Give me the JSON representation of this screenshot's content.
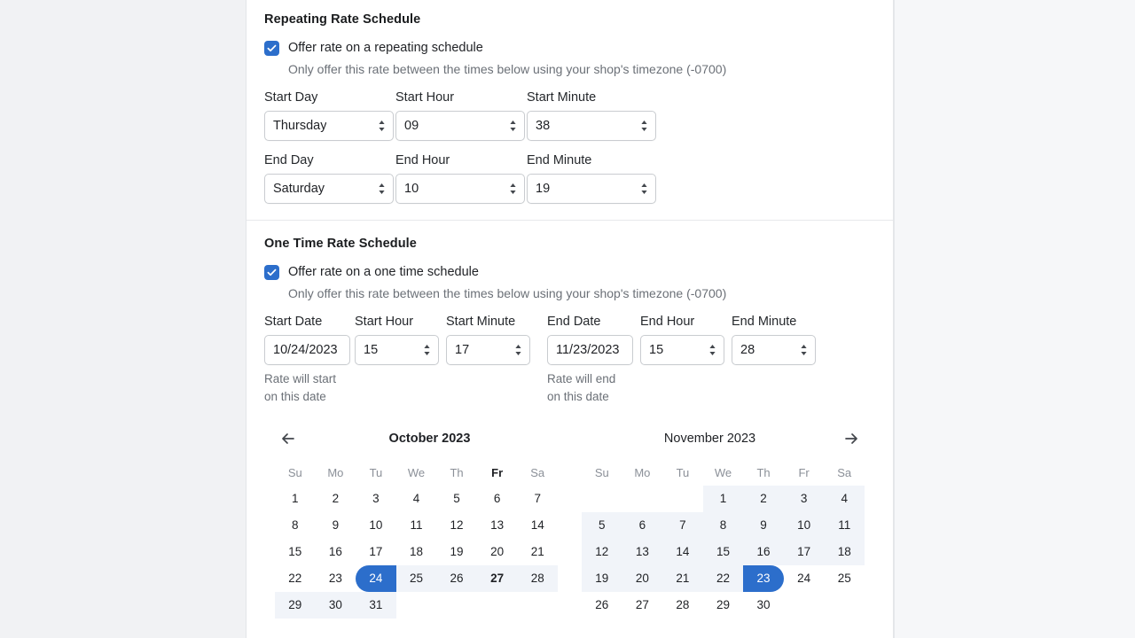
{
  "repeating": {
    "title": "Repeating Rate Schedule",
    "checkbox_label": "Offer rate on a repeating schedule",
    "helper": "Only offer this rate between the times below using your shop's timezone (-0700)",
    "fields": [
      {
        "label": "Start Day",
        "value": "Thursday",
        "type": "select"
      },
      {
        "label": "Start Hour",
        "value": "09",
        "type": "select"
      },
      {
        "label": "Start Minute",
        "value": "38",
        "type": "select"
      },
      {
        "label": "End Day",
        "value": "Saturday",
        "type": "select"
      },
      {
        "label": "End Hour",
        "value": "10",
        "type": "select"
      },
      {
        "label": "End Minute",
        "value": "19",
        "type": "select"
      }
    ]
  },
  "onetime": {
    "title": "One Time Rate Schedule",
    "checkbox_label": "Offer rate on a one time schedule",
    "helper": "Only offer this rate between the times below using your shop's timezone (-0700)",
    "fields": [
      {
        "label": "Start Date",
        "value": "10/24/2023",
        "type": "date",
        "hint": "Rate will start\non this date"
      },
      {
        "label": "Start Hour",
        "value": "15",
        "type": "select",
        "hint": ""
      },
      {
        "label": "Start Minute",
        "value": "17",
        "type": "select",
        "hint": ""
      },
      {
        "label": "End Date",
        "value": "11/23/2023",
        "type": "date",
        "hint": "Rate will end\non this date"
      },
      {
        "label": "End Hour",
        "value": "15",
        "type": "select",
        "hint": ""
      },
      {
        "label": "End Minute",
        "value": "28",
        "type": "select",
        "hint": ""
      }
    ]
  },
  "calendar": {
    "prev_icon": "arrow-left-icon",
    "next_icon": "arrow-right-icon",
    "weekdays": [
      "Su",
      "Mo",
      "Tu",
      "We",
      "Th",
      "Fr",
      "Sa"
    ],
    "accent": "#2c6ecb",
    "range_bg": "#f1f4f9",
    "months": [
      {
        "title": "October 2023",
        "today_weekday_index": 5,
        "lead_blanks": 0,
        "days_in_month": 31,
        "range_start": 24,
        "range_end": null,
        "today": 27,
        "in_range_from": 24,
        "in_range_to": 31
      },
      {
        "title": "November 2023",
        "today_weekday_index": -1,
        "lead_blanks": 3,
        "days_in_month": 30,
        "range_start": null,
        "range_end": 23,
        "today": null,
        "in_range_from": 1,
        "in_range_to": 23
      }
    ]
  }
}
